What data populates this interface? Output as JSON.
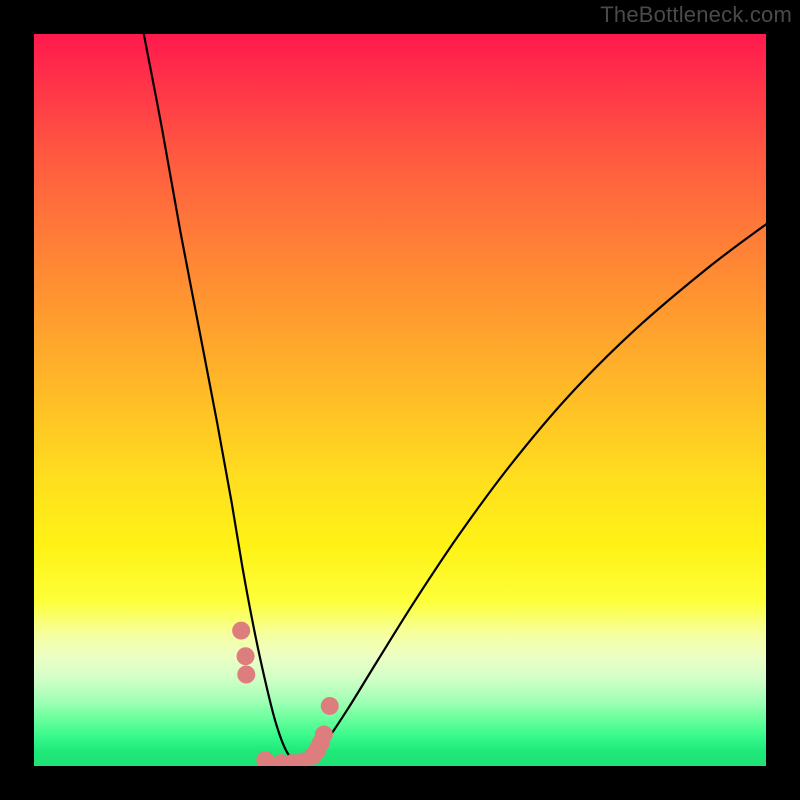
{
  "watermark": "TheBottleneck.com",
  "chart_data": {
    "type": "line",
    "title": "",
    "xlabel": "",
    "ylabel": "",
    "xlim": [
      0,
      100
    ],
    "ylim": [
      0,
      100
    ],
    "note": "Axes are unlabeled; values are relative percentages of the plot area width/height, read from pixel positions. y=0 is the green floor (optimum), y=100 is top-of-plot. The curve is a bottleneck V-shape with minimum near x≈35.",
    "series": [
      {
        "name": "bottleneck-curve",
        "color": "#000000",
        "x": [
          15.0,
          17.5,
          20.0,
          22.5,
          25.0,
          27.0,
          28.5,
          30.0,
          31.5,
          33.0,
          34.5,
          36.0,
          38.0,
          40.0,
          43.0,
          47.0,
          52.0,
          58.0,
          65.0,
          73.0,
          82.0,
          92.0,
          100.0
        ],
        "y": [
          100.0,
          87.0,
          73.0,
          60.0,
          47.0,
          36.0,
          27.0,
          19.0,
          12.0,
          6.0,
          2.0,
          0.5,
          1.0,
          3.5,
          8.0,
          14.5,
          22.5,
          31.5,
          41.0,
          50.5,
          59.5,
          68.0,
          74.0
        ]
      },
      {
        "name": "highlight-dots",
        "color": "#de7d7d",
        "type": "scatter",
        "x": [
          28.3,
          28.9,
          29.0,
          31.6,
          33.8,
          35.3,
          36.6,
          38.1,
          38.7,
          39.2,
          39.6,
          40.4
        ],
        "y": [
          18.5,
          15.0,
          12.5,
          0.8,
          0.4,
          0.4,
          0.6,
          1.4,
          2.2,
          3.2,
          4.3,
          8.2
        ]
      }
    ]
  }
}
